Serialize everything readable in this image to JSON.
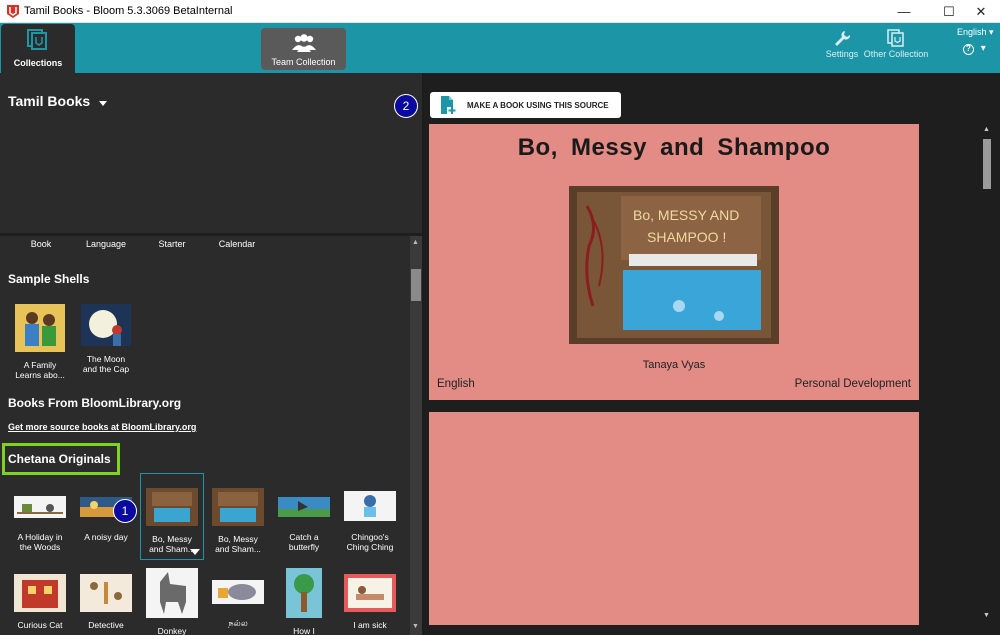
{
  "window": {
    "title": "Tamil Books - Bloom 5.3.3069 BetaInternal",
    "minimize": "—",
    "maximize": "☐",
    "close": "✕"
  },
  "toolbar": {
    "collections_label": "Collections",
    "team_collection_label": "Team Collection",
    "settings_label": "Settings",
    "other_collection_label": "Other Collection",
    "language": "English",
    "language_arrow": "▾",
    "help": "?"
  },
  "collection": {
    "title": "Tamil Books"
  },
  "shell_captions": [
    "Book",
    "Language",
    "Starter",
    "Calendar"
  ],
  "sections": {
    "sample_shells": "Sample Shells",
    "bloom_library": "Books From BloomLibrary.org",
    "more_link": "Get more source books at BloomLibrary.org",
    "chetana": "Chetana Originals"
  },
  "sample_shells": [
    {
      "line1": "A Family",
      "line2": "Learns abo..."
    },
    {
      "line1": "The Moon",
      "line2": "and the Cap"
    }
  ],
  "chetana_row1": [
    {
      "line1": "A Holiday in",
      "line2": "the Woods"
    },
    {
      "line1": "A noisy day",
      "line2": ""
    },
    {
      "line1": "Bo, Messy",
      "line2": "and Sham..."
    },
    {
      "line1": "Bo, Messy",
      "line2": "and Sham..."
    },
    {
      "line1": "Catch a",
      "line2": "butterfly"
    },
    {
      "line1": "Chingoo's",
      "line2": "Ching Ching"
    }
  ],
  "chetana_row2": [
    {
      "line1": "Curious Cat"
    },
    {
      "line1": "Detective"
    },
    {
      "line1": "Donkey"
    },
    {
      "line1": "நல்ல"
    },
    {
      "line1": "How I"
    },
    {
      "line1": "I am sick"
    }
  ],
  "badges": {
    "one": "1",
    "two": "2"
  },
  "source": {
    "make_button": "MAKE A BOOK USING THIS SOURCE",
    "title": "Bo, Messy and Shampoo",
    "cover_text_line1": "Bo, MESSY AND",
    "cover_text_line2": "SHAMPOO !",
    "author": "Tanaya Vyas",
    "language": "English",
    "topic": "Personal Development"
  },
  "colors": {
    "teal": "#1c96a7",
    "panel": "#2b2b2b",
    "preview_bg": "#e38b85",
    "highlight": "#7ed321",
    "badge": "#0a0aa0"
  }
}
